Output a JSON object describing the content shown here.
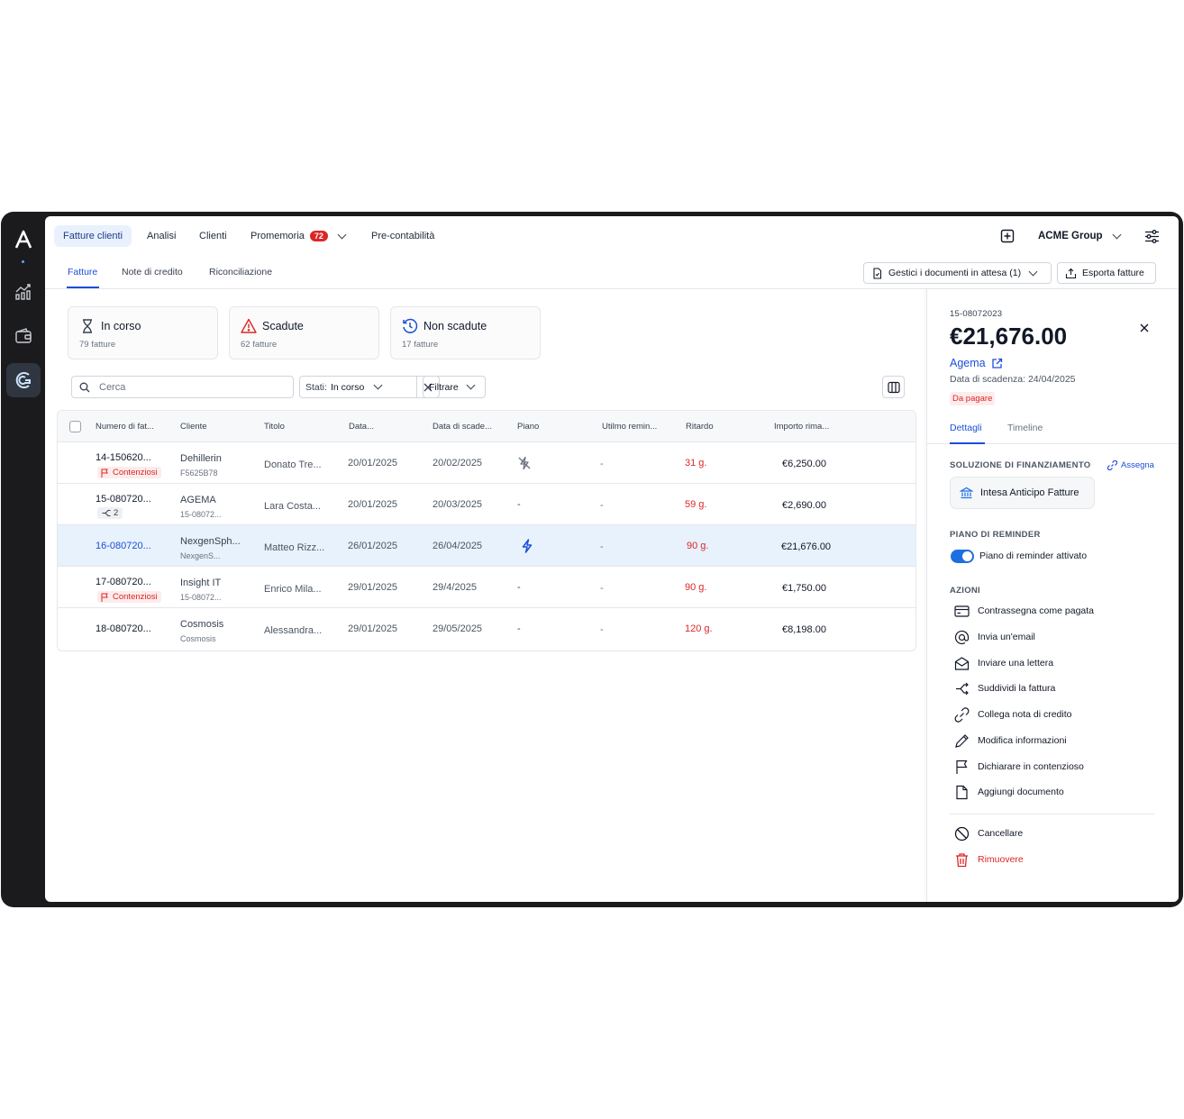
{
  "rail": {
    "logo": "A"
  },
  "nav": {
    "tabs": [
      {
        "label": "Fatture clienti"
      },
      {
        "label": "Analisi"
      },
      {
        "label": "Clienti"
      },
      {
        "label": "Promemoria",
        "badge": "72"
      },
      {
        "label": "Pre-contabilità"
      }
    ],
    "org": "ACME Group"
  },
  "subnav": {
    "tabs": [
      {
        "label": "Fatture"
      },
      {
        "label": "Note di credito"
      },
      {
        "label": "Riconciliazione"
      }
    ],
    "pending_label": "Gestici i documenti in attesa (1)",
    "export_label": "Esporta fatture"
  },
  "cards": [
    {
      "title": "In corso",
      "sub": "79 fatture",
      "icon": "hourglass-icon",
      "color": "#374151"
    },
    {
      "title": "Scadute",
      "sub": "62 fatture",
      "icon": "warning-icon",
      "color": "#dc2626"
    },
    {
      "title": "Non scadute",
      "sub": "17 fatture",
      "icon": "clock-icon",
      "color": "#1d4ed8"
    }
  ],
  "toolbar": {
    "search_placeholder": "Cerca",
    "stati_label": "Stati:",
    "stati_value": "In corso",
    "filter_label": "Filtrare"
  },
  "table": {
    "headers": [
      "Numero di fat...",
      "Cliente",
      "Titolo",
      "Data...",
      "Data di scade...",
      "Piano",
      "Utilmo remin...",
      "Ritardo",
      "Importo rima..."
    ],
    "rows": [
      {
        "num": "14-150620...",
        "tag": "Contenziosi",
        "client": "Dehillerin",
        "client_sub": "F5625B78",
        "title": "Donato Tre...",
        "date": "20/01/2025",
        "due": "20/02/2025",
        "plan": "no-flash-icon",
        "last": "-",
        "delay": "31 g.",
        "amount": "€6,250.00"
      },
      {
        "num": "15-080720...",
        "split": "2",
        "client": "AGEMA",
        "client_sub": "15-08072...",
        "title": "Lara Costa...",
        "date": "20/01/2025",
        "due": "20/03/2025",
        "plan": "-",
        "last": "-",
        "delay": "59 g.",
        "amount": "€2,690.00"
      },
      {
        "num": "16-080720...",
        "client": "NexgenSph...",
        "client_sub": "NexgenS...",
        "title": "Matteo Rizz...",
        "date": "26/01/2025",
        "due": "26/04/2025",
        "plan": "flash-icon",
        "last": "-",
        "delay": "90 g.",
        "amount": "€21,676.00"
      },
      {
        "num": "17-080720...",
        "tag": "Contenziosi",
        "client": "Insight IT",
        "client_sub": "15-08072...",
        "title": "Enrico Mila...",
        "date": "29/01/2025",
        "due": "29/4/2025",
        "plan": "-",
        "last": "-",
        "delay": "90 g.",
        "amount": "€1,750.00"
      },
      {
        "num": "18-080720...",
        "client": "Cosmosis",
        "client_sub": "Cosmosis",
        "title": "Alessandra...",
        "date": "29/01/2025",
        "due": "29/05/2025",
        "plan": "-",
        "last": "-",
        "delay": "120 g.",
        "amount": "€8,198.00"
      }
    ]
  },
  "panel": {
    "invoice_id": "15-08072023",
    "amount": "€21,676.00",
    "client": "Agema",
    "due_date": "Data di scadenza: 24/04/2025",
    "status": "Da pagare",
    "tabs": [
      "Dettagli",
      "Timeline"
    ],
    "financing_title": "SOLUZIONE DI FINANZIAMENTO",
    "assign_label": "Assegna",
    "financing_value": "Intesa Anticipo Fatture",
    "reminder_title": "PIANO DI REMINDER",
    "reminder_label": "Piano di reminder attivato",
    "reminder_on": true,
    "actions_title": "AZIONI",
    "actions": [
      {
        "label": "Contrassegna come pagata",
        "icon": "card-icon"
      },
      {
        "label": "Invia un'email",
        "icon": "at-icon"
      },
      {
        "label": "Inviare una lettera",
        "icon": "envelope-icon"
      },
      {
        "label": "Suddividi la fattura",
        "icon": "split-icon"
      },
      {
        "label": "Collega nota di credito",
        "icon": "link-icon"
      },
      {
        "label": "Modifica informazioni",
        "icon": "pencil-icon"
      },
      {
        "label": "Dichiarare in contenzioso",
        "icon": "flag-icon"
      },
      {
        "label": "Aggiungi documento",
        "icon": "document-icon"
      }
    ],
    "cancel_label": "Cancellare",
    "remove_label": "Rimuovere"
  },
  "colors": {
    "accent": "#1d4ed8",
    "danger": "#dc2626",
    "selected_row": "#e7f2fc",
    "rail": "#1b1b1d"
  }
}
